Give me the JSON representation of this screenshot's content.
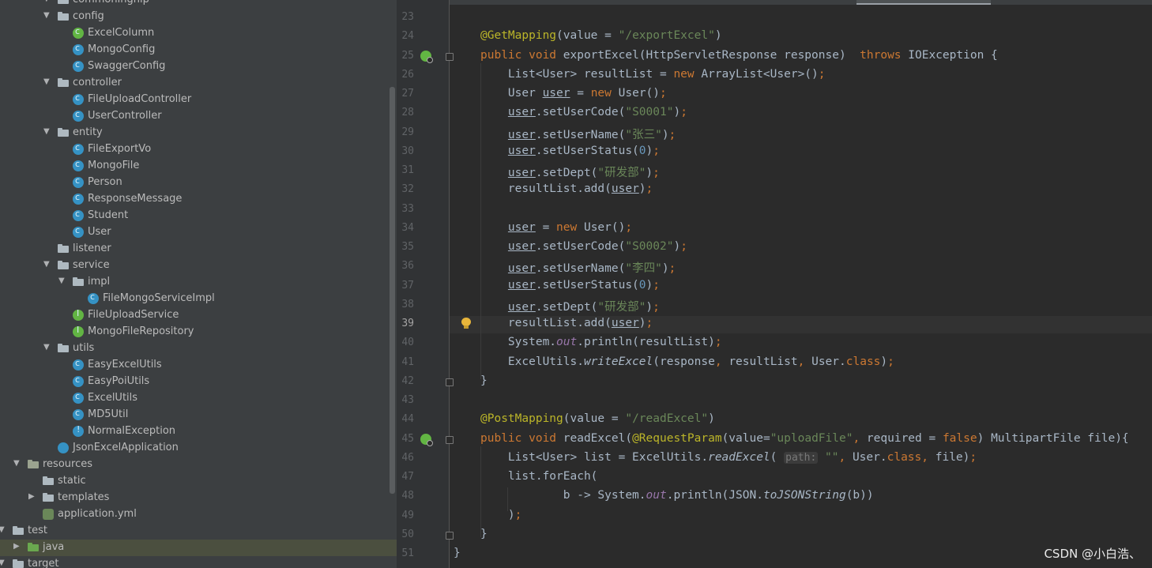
{
  "tree": {
    "items": [
      {
        "label": "commoningnip",
        "level": 3,
        "kind": "folder",
        "expanded": true
      },
      {
        "label": "config",
        "level": 3,
        "kind": "folder",
        "expanded": true
      },
      {
        "label": "ExcelColumn",
        "level": 4,
        "kind": "enum"
      },
      {
        "label": "MongoConfig",
        "level": 4,
        "kind": "class"
      },
      {
        "label": "SwaggerConfig",
        "level": 4,
        "kind": "class"
      },
      {
        "label": "controller",
        "level": 3,
        "kind": "folder",
        "expanded": true
      },
      {
        "label": "FileUploadController",
        "level": 4,
        "kind": "class"
      },
      {
        "label": "UserController",
        "level": 4,
        "kind": "class"
      },
      {
        "label": "entity",
        "level": 3,
        "kind": "folder",
        "expanded": true
      },
      {
        "label": "FileExportVo",
        "level": 4,
        "kind": "class"
      },
      {
        "label": "MongoFile",
        "level": 4,
        "kind": "class"
      },
      {
        "label": "Person",
        "level": 4,
        "kind": "class"
      },
      {
        "label": "ResponseMessage",
        "level": 4,
        "kind": "class"
      },
      {
        "label": "Student",
        "level": 4,
        "kind": "class"
      },
      {
        "label": "User",
        "level": 4,
        "kind": "class"
      },
      {
        "label": "listener",
        "level": 3,
        "kind": "folder",
        "expanded": null
      },
      {
        "label": "service",
        "level": 3,
        "kind": "folder",
        "expanded": true
      },
      {
        "label": "impl",
        "level": 4,
        "kind": "folder",
        "expanded": true
      },
      {
        "label": "FileMongoServiceImpl",
        "level": 5,
        "kind": "class"
      },
      {
        "label": "FileUploadService",
        "level": 4,
        "kind": "interface"
      },
      {
        "label": "MongoFileRepository",
        "level": 4,
        "kind": "interface"
      },
      {
        "label": "utils",
        "level": 3,
        "kind": "folder",
        "expanded": true
      },
      {
        "label": "EasyExcelUtils",
        "level": 4,
        "kind": "class"
      },
      {
        "label": "EasyPoiUtils",
        "level": 4,
        "kind": "class"
      },
      {
        "label": "ExcelUtils",
        "level": 4,
        "kind": "class"
      },
      {
        "label": "MD5Util",
        "level": 4,
        "kind": "class"
      },
      {
        "label": "NormalException",
        "level": 4,
        "kind": "exception"
      },
      {
        "label": "JsonExcelApplication",
        "level": 3,
        "kind": "spring"
      },
      {
        "label": "resources",
        "level": 1,
        "kind": "res-folder",
        "expanded": true
      },
      {
        "label": "static",
        "level": 2,
        "kind": "folder",
        "expanded": null
      },
      {
        "label": "templates",
        "level": 2,
        "kind": "folder",
        "expanded": false
      },
      {
        "label": "application.yml",
        "level": 2,
        "kind": "yml"
      },
      {
        "label": "test",
        "level": 0,
        "kind": "folder",
        "expanded": true
      },
      {
        "label": "java",
        "level": 1,
        "kind": "src-folder",
        "expanded": false,
        "selected": true
      },
      {
        "label": "target",
        "level": 0,
        "kind": "folder",
        "expanded": true
      }
    ]
  },
  "editor": {
    "current_line": 39,
    "lines": [
      {
        "n": 23,
        "tokens": []
      },
      {
        "n": 24,
        "tokens": [
          [
            "an",
            "@GetMapping"
          ],
          [
            "p",
            "(value = "
          ],
          [
            "str",
            "\"/exportExcel\""
          ],
          [
            "p",
            ")"
          ]
        ]
      },
      {
        "n": 25,
        "icon": true,
        "fold": true,
        "tokens": [
          [
            "kw",
            "public void "
          ],
          [
            "p",
            "exportExcel(HttpServletResponse response)  "
          ],
          [
            "kw",
            "throws "
          ],
          [
            "p",
            "IOException {"
          ]
        ]
      },
      {
        "n": 26,
        "tokens": [
          [
            "p",
            "    List<User> resultList = "
          ],
          [
            "kw",
            "new "
          ],
          [
            "p",
            "ArrayList<User>()"
          ],
          [
            "kw",
            ";"
          ]
        ]
      },
      {
        "n": 27,
        "tokens": [
          [
            "p",
            "    User "
          ],
          [
            "ul",
            "user"
          ],
          [
            "p",
            " = "
          ],
          [
            "kw",
            "new "
          ],
          [
            "p",
            "User()"
          ],
          [
            "kw",
            ";"
          ]
        ]
      },
      {
        "n": 28,
        "tokens": [
          [
            "p",
            "    "
          ],
          [
            "ul",
            "user"
          ],
          [
            "p",
            ".setUserCode("
          ],
          [
            "str",
            "\"S0001\""
          ],
          [
            "p",
            ")"
          ],
          [
            "kw",
            ";"
          ]
        ]
      },
      {
        "n": 29,
        "tokens": [
          [
            "p",
            "    "
          ],
          [
            "ul",
            "user"
          ],
          [
            "p",
            ".setUserName("
          ],
          [
            "str",
            "\"张三\""
          ],
          [
            "p",
            ")"
          ],
          [
            "kw",
            ";"
          ]
        ]
      },
      {
        "n": 30,
        "tokens": [
          [
            "p",
            "    "
          ],
          [
            "ul",
            "user"
          ],
          [
            "p",
            ".setUserStatus("
          ],
          [
            "num",
            "0"
          ],
          [
            "p",
            ")"
          ],
          [
            "kw",
            ";"
          ]
        ]
      },
      {
        "n": 31,
        "tokens": [
          [
            "p",
            "    "
          ],
          [
            "ul",
            "user"
          ],
          [
            "p",
            ".setDept("
          ],
          [
            "str",
            "\"研发部\""
          ],
          [
            "p",
            ")"
          ],
          [
            "kw",
            ";"
          ]
        ]
      },
      {
        "n": 32,
        "tokens": [
          [
            "p",
            "    resultList.add("
          ],
          [
            "ul",
            "user"
          ],
          [
            "p",
            ")"
          ],
          [
            "kw",
            ";"
          ]
        ]
      },
      {
        "n": 33,
        "tokens": []
      },
      {
        "n": 34,
        "tokens": [
          [
            "p",
            "    "
          ],
          [
            "ul",
            "user"
          ],
          [
            "p",
            " = "
          ],
          [
            "kw",
            "new "
          ],
          [
            "p",
            "User()"
          ],
          [
            "kw",
            ";"
          ]
        ]
      },
      {
        "n": 35,
        "tokens": [
          [
            "p",
            "    "
          ],
          [
            "ul",
            "user"
          ],
          [
            "p",
            ".setUserCode("
          ],
          [
            "str",
            "\"S0002\""
          ],
          [
            "p",
            ")"
          ],
          [
            "kw",
            ";"
          ]
        ]
      },
      {
        "n": 36,
        "tokens": [
          [
            "p",
            "    "
          ],
          [
            "ul",
            "user"
          ],
          [
            "p",
            ".setUserName("
          ],
          [
            "str",
            "\"李四\""
          ],
          [
            "p",
            ")"
          ],
          [
            "kw",
            ";"
          ]
        ]
      },
      {
        "n": 37,
        "tokens": [
          [
            "p",
            "    "
          ],
          [
            "ul",
            "user"
          ],
          [
            "p",
            ".setUserStatus("
          ],
          [
            "num",
            "0"
          ],
          [
            "p",
            ")"
          ],
          [
            "kw",
            ";"
          ]
        ]
      },
      {
        "n": 38,
        "tokens": [
          [
            "p",
            "    "
          ],
          [
            "ul",
            "user"
          ],
          [
            "p",
            ".setDept("
          ],
          [
            "str",
            "\"研发部\""
          ],
          [
            "p",
            ")"
          ],
          [
            "kw",
            ";"
          ]
        ]
      },
      {
        "n": 39,
        "bulb": true,
        "tokens": [
          [
            "p",
            "    resultList.add("
          ],
          [
            "ul",
            "user"
          ],
          [
            "p",
            ")"
          ],
          [
            "kw",
            ";"
          ]
        ]
      },
      {
        "n": 40,
        "tokens": [
          [
            "p",
            "    System."
          ],
          [
            "fld",
            "out"
          ],
          [
            "p",
            ".println(resultList)"
          ],
          [
            "kw",
            ";"
          ]
        ]
      },
      {
        "n": 41,
        "tokens": [
          [
            "p",
            "    ExcelUtils."
          ],
          [
            "stat",
            "writeExcel"
          ],
          [
            "p",
            "(response"
          ],
          [
            "kw",
            ", "
          ],
          [
            "p",
            "resultList"
          ],
          [
            "kw",
            ", "
          ],
          [
            "p",
            "User."
          ],
          [
            "kw",
            "class"
          ],
          [
            "p",
            ")"
          ],
          [
            "kw",
            ";"
          ]
        ]
      },
      {
        "n": 42,
        "fold": true,
        "tokens": [
          [
            "p",
            "}"
          ]
        ]
      },
      {
        "n": 43,
        "tokens": []
      },
      {
        "n": 44,
        "tokens": [
          [
            "an",
            "@PostMapping"
          ],
          [
            "p",
            "(value = "
          ],
          [
            "str",
            "\"/readExcel\""
          ],
          [
            "p",
            ")"
          ]
        ]
      },
      {
        "n": 45,
        "icon": true,
        "fold": true,
        "tokens": [
          [
            "kw",
            "public void "
          ],
          [
            "p",
            "readExcel("
          ],
          [
            "an",
            "@RequestParam"
          ],
          [
            "p",
            "(value="
          ],
          [
            "str",
            "\"uploadFile\""
          ],
          [
            "kw",
            ", "
          ],
          [
            "p",
            "required = "
          ],
          [
            "kw",
            "false"
          ],
          [
            "p",
            ") MultipartFile file){"
          ]
        ]
      },
      {
        "n": 46,
        "tokens": [
          [
            "p",
            "    List<User> list = ExcelUtils."
          ],
          [
            "stat",
            "readExcel"
          ],
          [
            "p",
            "( "
          ],
          [
            "hint",
            "path:"
          ],
          [
            "p",
            " "
          ],
          [
            "str",
            "\"\""
          ],
          [
            "kw",
            ", "
          ],
          [
            "p",
            "User."
          ],
          [
            "kw",
            "class"
          ],
          [
            "kw",
            ", "
          ],
          [
            "p",
            "file)"
          ],
          [
            "kw",
            ";"
          ]
        ]
      },
      {
        "n": 47,
        "tokens": [
          [
            "p",
            "    list.forEach("
          ]
        ]
      },
      {
        "n": 48,
        "tokens": [
          [
            "p",
            "            b -> System."
          ],
          [
            "fld",
            "out"
          ],
          [
            "p",
            ".println(JSON."
          ],
          [
            "stat",
            "toJSONString"
          ],
          [
            "p",
            "(b))"
          ]
        ]
      },
      {
        "n": 49,
        "tokens": [
          [
            "p",
            "    )"
          ],
          [
            "kw",
            ";"
          ]
        ]
      },
      {
        "n": 50,
        "fold": true,
        "tokens": [
          [
            "p",
            "}"
          ]
        ]
      },
      {
        "n": 51,
        "tokens": [
          [
            "p",
            "}"
          ]
        ],
        "outer": true
      }
    ]
  },
  "watermark": "CSDN @小白浩、"
}
